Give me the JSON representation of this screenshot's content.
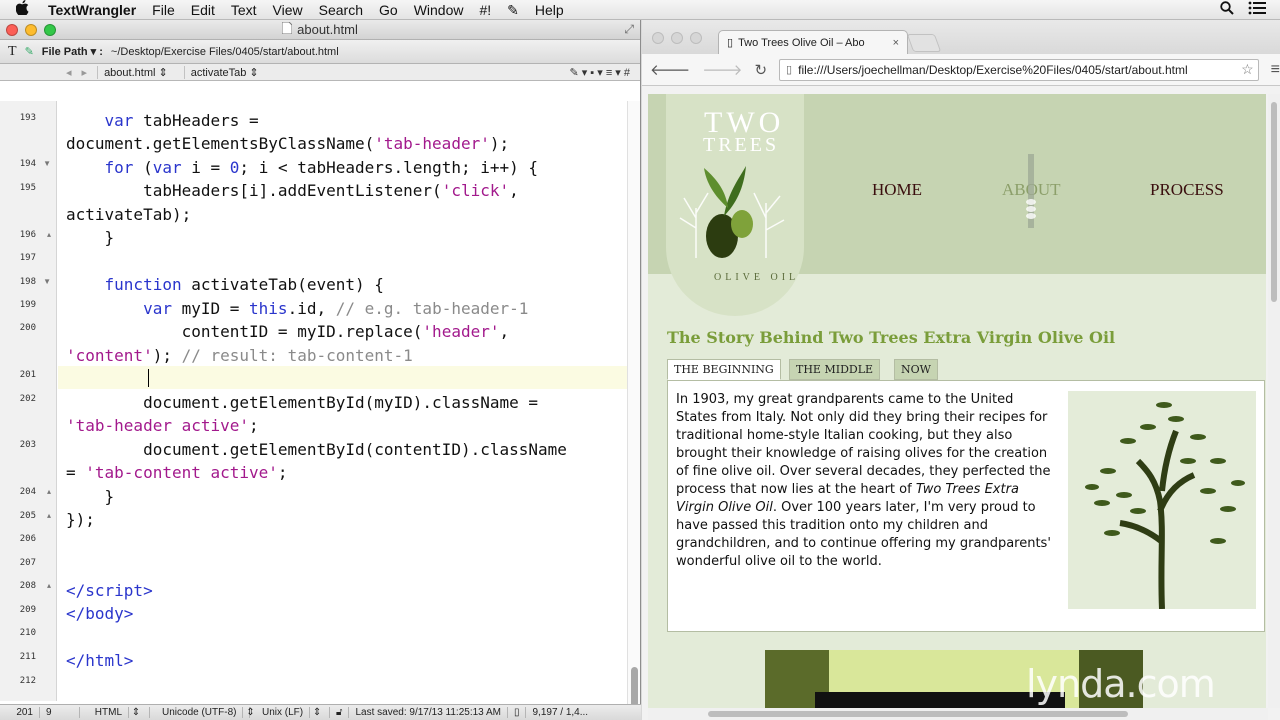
{
  "menubar": {
    "app": "TextWrangler",
    "items": [
      "File",
      "Edit",
      "Text",
      "View",
      "Search",
      "Go",
      "Window",
      "#!",
      "Help"
    ]
  },
  "editor": {
    "title": "about.html",
    "file_path_label": "File Path ▾ :",
    "file_path": "~/Desktop/Exercise Files/0405/start/about.html",
    "nav_file": "about.html",
    "nav_function": "activateTab",
    "line_numbers": [
      "193",
      "194",
      "195",
      "196",
      "197",
      "198",
      "199",
      "200",
      "201",
      "202",
      "203",
      "204",
      "205",
      "206",
      "207",
      "208",
      "209",
      "210",
      "211",
      "212"
    ],
    "status": {
      "position": "201",
      "col": "9",
      "language": "HTML",
      "encoding": "Unicode (UTF-8)",
      "line_endings": "Unix (LF)",
      "saved": "Last saved: 9/17/13 11:25:13 AM",
      "counts": "9,197 / 1,4..."
    }
  },
  "browser": {
    "tab_title": "Two Trees Olive Oil – Abo",
    "url": "file:///Users/joechellman/Desktop/Exercise%20Files/0405/start/about.html"
  },
  "site": {
    "logo_line1": "TWO",
    "logo_line2": "TREES",
    "logo_sub": "OLIVE OIL",
    "nav": [
      "HOME",
      "ABOUT",
      "PROCESS"
    ],
    "heading": "The Story Behind Two Trees Extra Virgin Olive Oil",
    "tabs": [
      "THE BEGINNING",
      "THE MIDDLE",
      "NOW"
    ],
    "para_a": "In 1903, my great grandparents came to the United States from Italy. Not only did they bring their recipes for traditional home-style Italian cooking, but they also brought their knowledge of raising olives for the creation of fine olive oil. Over several decades, they perfected the process that now lies at the heart of ",
    "para_em": "Two Trees Extra Virgin Olive Oil",
    "para_b": ". Over 100 years later, I'm very proud to have passed this tradition onto my children and grandchildren, and to continue offering my grandparents' wonderful olive oil to the world."
  },
  "watermark": "lynda.com"
}
